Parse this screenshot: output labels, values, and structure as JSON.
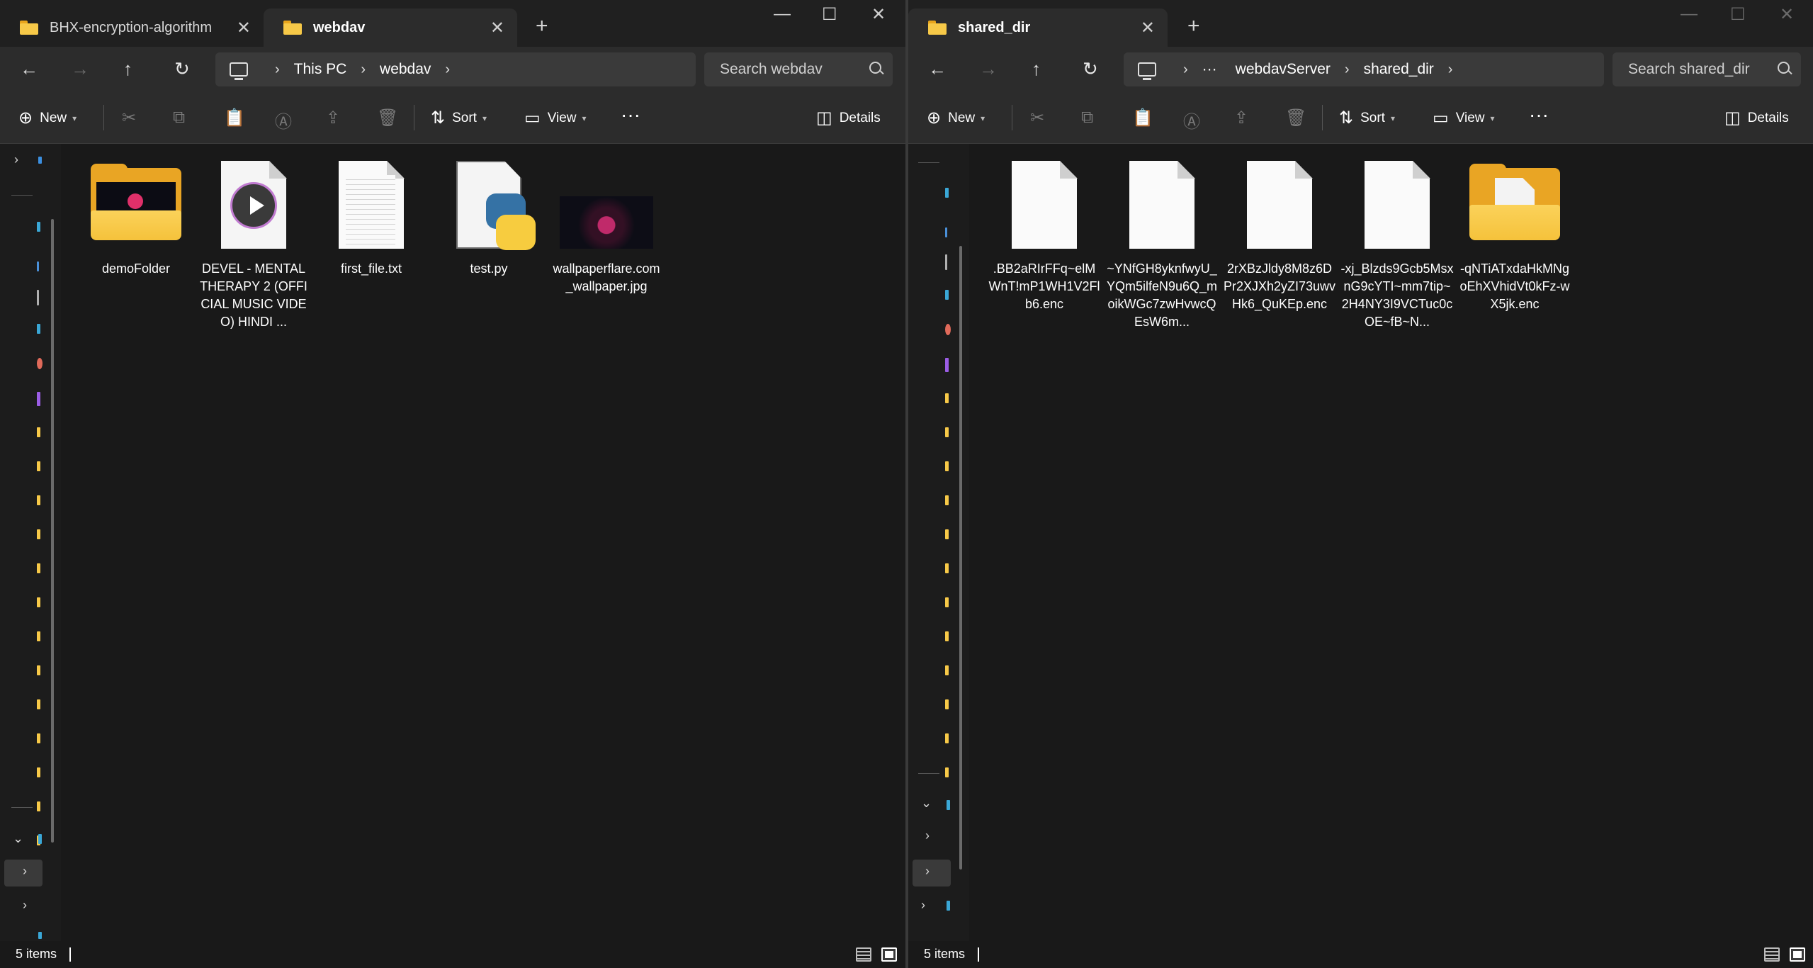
{
  "left": {
    "tabs": [
      {
        "label": "BHX-encryption-algorithm"
      },
      {
        "label": "webdav"
      }
    ],
    "breadcrumb": [
      "This PC",
      "webdav"
    ],
    "search_placeholder": "Search webdav",
    "toolbar": {
      "new": "New",
      "sort": "Sort",
      "view": "View",
      "details": "Details"
    },
    "items": [
      {
        "label": "demoFolder",
        "kind": "folder-video"
      },
      {
        "label": "DEVEL - MENTAL THERAPY 2 (OFFICIAL MUSIC VIDEO) HINDI ...",
        "kind": "media"
      },
      {
        "label": "first_file.txt",
        "kind": "text"
      },
      {
        "label": "test.py",
        "kind": "python"
      },
      {
        "label": "wallpaperflare.com_wallpaper.jpg",
        "kind": "image"
      }
    ],
    "status": "5 items"
  },
  "right": {
    "tabs": [
      {
        "label": "shared_dir"
      }
    ],
    "breadcrumb_overflow": "···",
    "breadcrumb": [
      "webdavServer",
      "shared_dir"
    ],
    "search_placeholder": "Search shared_dir",
    "toolbar": {
      "new": "New",
      "sort": "Sort",
      "view": "View",
      "details": "Details"
    },
    "items": [
      {
        "label": ".BB2aRIrFFq~elMWnT!mP1WH1V2Flb6.enc",
        "kind": "blank"
      },
      {
        "label": "~YNfGH8yknfwyU_YQm5ilfeN9u6Q_moikWGc7zwHvwcQEsW6m...",
        "kind": "blank"
      },
      {
        "label": "2rXBzJldy8M8z6DPr2XJXh2yZI73uwvHk6_QuKEp.enc",
        "kind": "blank"
      },
      {
        "label": "-xj_Blzds9Gcb5MsxnG9cYTI~mm7tip~2H4NY3I9VCTuc0cOE~fB~N...",
        "kind": "blank"
      },
      {
        "label": "-qNTiATxdaHkMNgoEhXVhidVt0kFz-wX5jk.enc",
        "kind": "folder-doc"
      }
    ],
    "status": "5 items"
  },
  "icons": {
    "close": "✕",
    "add": "+",
    "minimize": "—",
    "maximize": "☐",
    "back": "←",
    "forward": "→",
    "up": "↑",
    "refresh": "↻",
    "chevron": "›",
    "more": "···",
    "expand": "›",
    "collapse": "⌄",
    "new": "⊕",
    "cut": "✂",
    "copy": "⧉",
    "paste": "📋",
    "rename": "Ⓐ",
    "share": "⇪",
    "delete": "🗑",
    "sort": "⇅",
    "view": "▭",
    "details": "◫"
  },
  "colors": {
    "folder": "#f7c948",
    "background": "#191919",
    "toolbar": "#2c2c2c"
  }
}
